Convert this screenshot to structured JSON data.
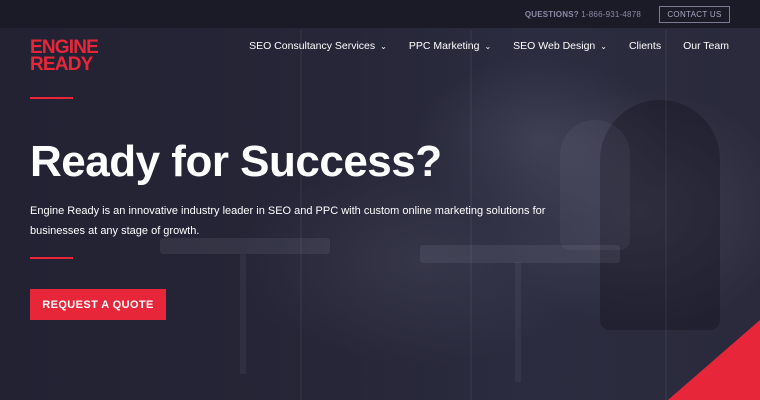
{
  "topbar": {
    "questions_label": "QUESTIONS?",
    "phone": "1-866-931-4878",
    "contact_label": "CONTACT US"
  },
  "logo": {
    "line1": "ENGINE",
    "line2": "READY"
  },
  "nav": {
    "items": [
      {
        "label": "SEO Consultancy Services",
        "has_dropdown": true
      },
      {
        "label": "PPC Marketing",
        "has_dropdown": true
      },
      {
        "label": "SEO Web Design",
        "has_dropdown": true
      },
      {
        "label": "Clients",
        "has_dropdown": false
      },
      {
        "label": "Our Team",
        "has_dropdown": false
      }
    ]
  },
  "hero": {
    "headline": "Ready for Success?",
    "description": "Engine Ready is an innovative industry leader in SEO and PPC with custom online marketing solutions for businesses at any stage of growth.",
    "cta_label": "REQUEST A QUOTE"
  },
  "colors": {
    "brand_red": "#e8263a",
    "background": "#262638",
    "topbar": "#1b1b28"
  },
  "icons": {
    "dropdown": "chevron-down-icon"
  }
}
